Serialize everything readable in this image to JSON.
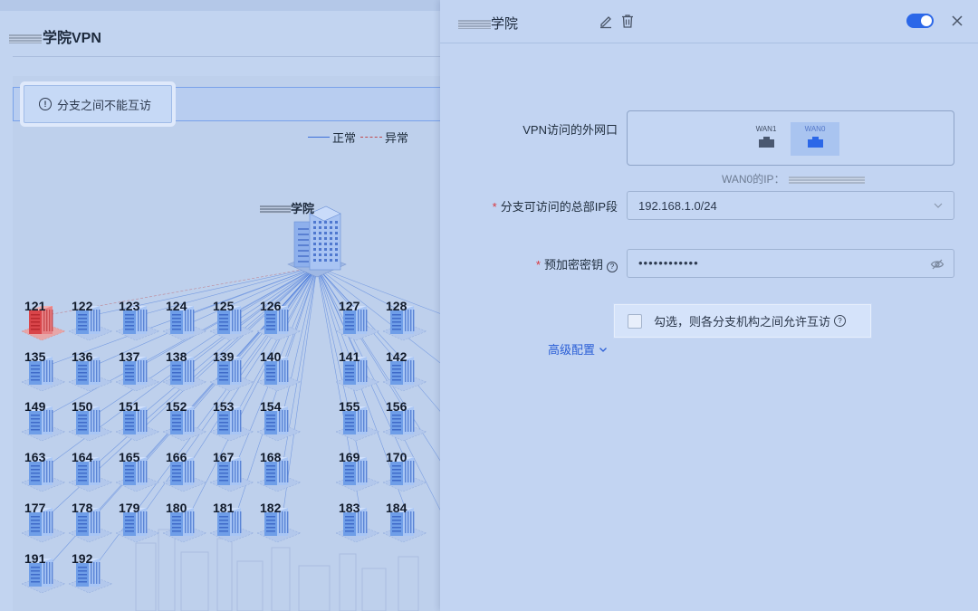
{
  "left_panel": {
    "title_suffix": "学院VPN",
    "alert_text": "分支之间不能互访",
    "legend": {
      "normal": "正常",
      "abnormal": "异常"
    },
    "hq_label_suffix": "学院",
    "branches": [
      "121",
      "122",
      "123",
      "124",
      "125",
      "126",
      "127",
      "128",
      "135",
      "136",
      "137",
      "138",
      "139",
      "140",
      "141",
      "142",
      "149",
      "150",
      "151",
      "152",
      "153",
      "154",
      "155",
      "156",
      "163",
      "164",
      "165",
      "166",
      "167",
      "168",
      "169",
      "170",
      "177",
      "178",
      "179",
      "180",
      "181",
      "182",
      "183",
      "184",
      "191",
      "192"
    ],
    "colors": {
      "normal_line": "#3b6fd9",
      "abnormal_line": "#c0484d",
      "building": "#6f9ee8",
      "abnormal_building": "#d9454a"
    }
  },
  "drawer": {
    "title_suffix": "学院",
    "toggle_on": true,
    "fields": {
      "wan_label": "VPN访问的外网口",
      "wan_ports": [
        {
          "name": "WAN1",
          "selected": false
        },
        {
          "name": "WAN0",
          "selected": true
        }
      ],
      "wan0_ip_label": "WAN0的IP：",
      "ip_label": "分支可访问的总部IP段",
      "ip_value": "192.168.1.0/24",
      "key_label": "预加密密钥",
      "key_value": "••••••••••••",
      "allow_label": "勾选，则各分支机构之间允许互访",
      "advanced_label": "高级配置"
    },
    "accent": "#2b67e8"
  }
}
